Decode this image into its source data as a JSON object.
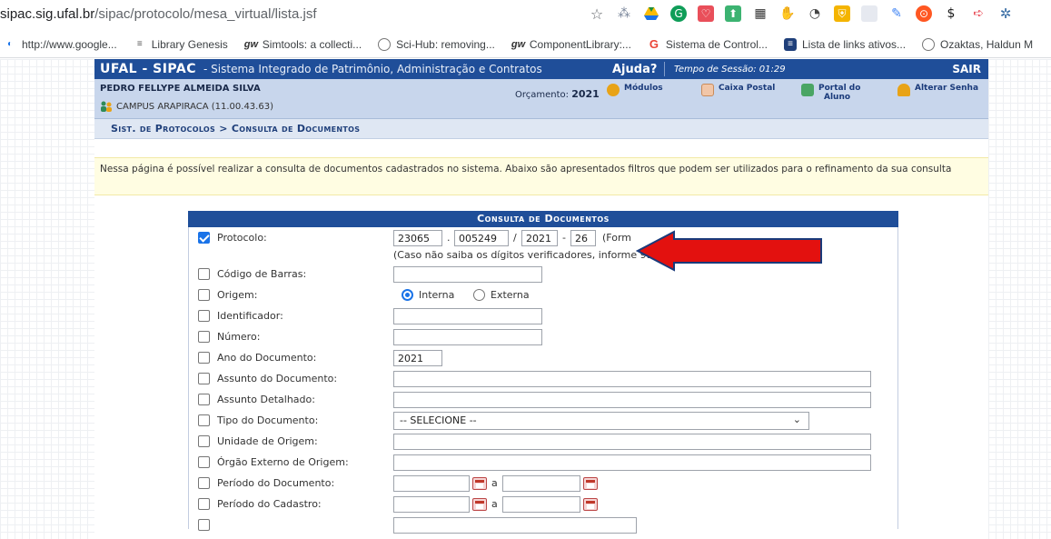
{
  "browser": {
    "url_host": "sipac.sig.ufal.br",
    "url_path": "/sipac/protocolo/mesa_virtual/lista.jsf",
    "bookmarks": [
      {
        "icon": "globe-icon",
        "label": "http://www.google..."
      },
      {
        "icon": "library-icon",
        "label": "Library Genesis"
      },
      {
        "icon": "gw-icon",
        "label": "Simtools: a collecti..."
      },
      {
        "icon": "globe-icon",
        "label": "Sci-Hub: removing..."
      },
      {
        "icon": "gw-icon",
        "label": "ComponentLibrary:..."
      },
      {
        "icon": "google-icon",
        "label": "Sistema de Control..."
      },
      {
        "icon": "list-icon",
        "label": "Lista de links ativos..."
      },
      {
        "icon": "globe-icon",
        "label": "Ozaktas, Haldun M"
      }
    ]
  },
  "header": {
    "brand": "UFAL - SIPAC",
    "system": "- Sistema Integrado de Patrimônio, Administração e Contratos",
    "help": "Ajuda?",
    "session": "Tempo de Sessão: 01:29",
    "logout": "SAIR"
  },
  "user": {
    "name": "PEDRO FELLYPE ALMEIDA SILVA",
    "campus": "CAMPUS ARAPIRACA (11.00.43.63)",
    "budget_label": "Orçamento:",
    "budget_year": "2021",
    "menu": {
      "modules": "Módulos",
      "mailbox": "Caixa Postal",
      "student_portal_1": "Portal do",
      "student_portal_2": "Aluno",
      "change_password": "Alterar Senha"
    }
  },
  "breadcrumb": "Sist. de Protocolos > Consulta de Documentos",
  "info": "Nessa página é possível realizar a consulta de documentos cadastrados no sistema. Abaixo são apresentados filtros que podem ser utilizados para o refinamento da sua consulta",
  "form": {
    "caption": "Consulta de Documentos",
    "protocolo": {
      "label": "Protocolo:",
      "checked": true,
      "part1": "23065",
      "part2": "005249",
      "part3": "2021",
      "part4": "26",
      "sep1": ".",
      "sep2": "/",
      "sep3": "-",
      "format_hint": "(Form",
      "hint": "(Caso não saiba os dígitos verificadores, informe 99)"
    },
    "codigo_barras": {
      "label": "Código de Barras:",
      "value": ""
    },
    "origem": {
      "label": "Origem:",
      "option_internal": "Interna",
      "option_external": "Externa",
      "selected": "Interna"
    },
    "identificador": {
      "label": "Identificador:",
      "value": ""
    },
    "numero": {
      "label": "Número:",
      "value": ""
    },
    "ano": {
      "label": "Ano do Documento:",
      "value": "2021"
    },
    "assunto": {
      "label": "Assunto do Documento:",
      "value": ""
    },
    "assunto_detalhado": {
      "label": "Assunto Detalhado:",
      "value": ""
    },
    "tipo": {
      "label": "Tipo do Documento:",
      "selected": "-- SELECIONE --"
    },
    "unidade": {
      "label": "Unidade de Origem:",
      "value": ""
    },
    "orgao": {
      "label": "Órgão Externo de Origem:",
      "value": ""
    },
    "periodo_doc": {
      "label": "Período do Documento:",
      "sep": "a"
    },
    "periodo_cad": {
      "label": "Período do Cadastro:",
      "sep": "a"
    }
  },
  "colors": {
    "brand_blue": "#1f4e99",
    "arrow_red": "#e3110f"
  }
}
